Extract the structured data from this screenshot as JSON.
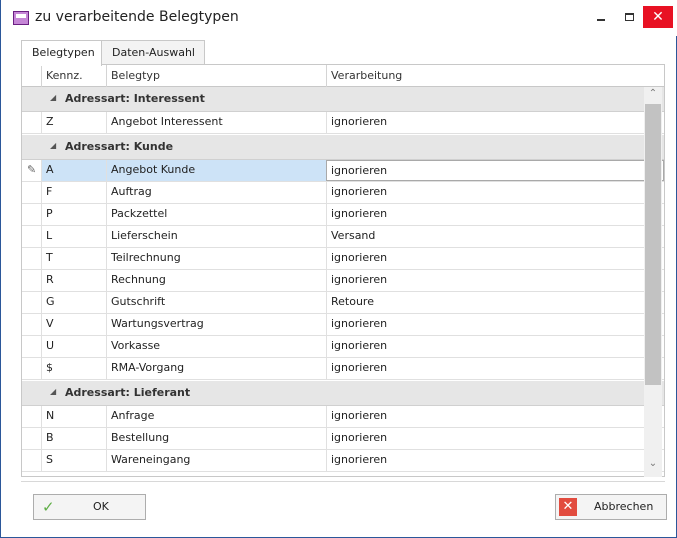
{
  "window": {
    "title": "zu verarbeitende Belegtypen",
    "icon": "app-window-icon",
    "minimize_glyph": "minimize-icon",
    "maximize_glyph": "maximize-icon",
    "close_label": "✕"
  },
  "tabs": [
    {
      "label": "Belegtypen",
      "active": true
    },
    {
      "label": "Daten-Auswahl",
      "active": false
    }
  ],
  "grid": {
    "columns": [
      "Kennz.",
      "Belegtyp",
      "Verarbeitung"
    ],
    "groups": [
      {
        "label": "Adressart: Interessent",
        "rows": [
          {
            "k": "Z",
            "t": "Angebot Interessent",
            "v": "ignorieren"
          }
        ]
      },
      {
        "label": "Adressart: Kunde",
        "rows": [
          {
            "k": "A",
            "t": "Angebot Kunde",
            "v": "ignorieren"
          },
          {
            "k": "F",
            "t": "Auftrag",
            "v": "ignorieren"
          },
          {
            "k": "P",
            "t": "Packzettel",
            "v": "ignorieren"
          },
          {
            "k": "L",
            "t": "Lieferschein",
            "v": "Versand"
          },
          {
            "k": "T",
            "t": "Teilrechnung",
            "v": "ignorieren"
          },
          {
            "k": "R",
            "t": "Rechnung",
            "v": "ignorieren"
          },
          {
            "k": "G",
            "t": "Gutschrift",
            "v": "Retoure"
          },
          {
            "k": "V",
            "t": "Wartungsvertrag",
            "v": "ignorieren"
          },
          {
            "k": "U",
            "t": "Vorkasse",
            "v": "ignorieren"
          },
          {
            "k": "$",
            "t": "RMA-Vorgang",
            "v": "ignorieren"
          }
        ]
      },
      {
        "label": "Adressart: Lieferant",
        "rows": [
          {
            "k": "N",
            "t": "Anfrage",
            "v": "ignorieren"
          },
          {
            "k": "B",
            "t": "Bestellung",
            "v": "ignorieren"
          },
          {
            "k": "S",
            "t": "Wareneingang",
            "v": "ignorieren"
          }
        ]
      }
    ],
    "group_arrow": "◢",
    "edit_indicator": "✎",
    "combo_arrow": "⌄",
    "scroll_up": "⌃",
    "scroll_down": "⌄"
  },
  "buttons": {
    "ok_label": "OK",
    "ok_icon": "✓",
    "cancel_label": "Abbrechen",
    "cancel_icon": "✕"
  },
  "colors": {
    "selection": "#cde3f7",
    "group_bg": "#e6e6e6",
    "close_red": "#e81123",
    "ok_green": "#5fae47",
    "cancel_red": "#e24c3f"
  }
}
